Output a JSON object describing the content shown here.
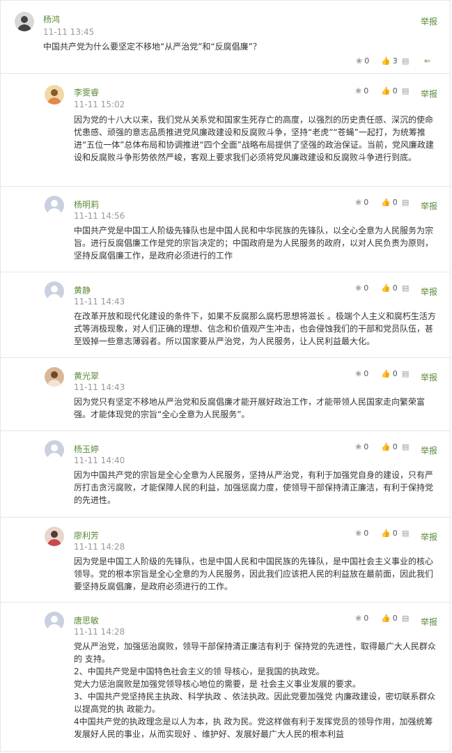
{
  "post": {
    "author": "杨鸿",
    "time": "11-11 13:45",
    "content": "中国共产党为什么要坚定不移地“从严治党”和“反腐倡廉”？",
    "report_label": "举报",
    "flowers": "0",
    "likes": "3"
  },
  "replies": [
    {
      "author": "李雯睿",
      "time": "11-11 15:02",
      "flowers": "0",
      "likes": "0",
      "report_label": "举报",
      "content": "因为党的十八大以来，我们党从关系党和国家生死存亡的高度，以强烈的历史责任感、深沉的使命忧患感、顽强的意志品质推进党风廉政建设和反腐败斗争，坚持“老虎”“苍蝇”一起打，为统筹推进“五位一体”总体布局和协调推进“四个全面”战略布局提供了坚强的政治保证。当前，党风廉政建设和反腐败斗争形势依然严峻，客观上要求我们必须将党风廉政建设和反腐败斗争进行到底。"
    },
    {
      "author": "杨明莉",
      "time": "11-11 14:56",
      "flowers": "0",
      "likes": "0",
      "report_label": "举报",
      "content": "中国共产党是中国工人阶级先锋队也是中国人民和中华民族的先锋队，以全心全意为人民服务为宗旨。进行反腐倡廉工作是党的宗旨决定的；中国政府是为人民服务的政府，以对人民负责为原则，坚持反腐倡廉工作，是政府必须进行的工作"
    },
    {
      "author": "黄静",
      "time": "11-11 14:43",
      "flowers": "0",
      "likes": "0",
      "report_label": "举报",
      "content": "在改革开放和现代化建设的条件下，如果不反腐那么腐朽思想将滋长 。极端个人主义和腐朽生活方式等消极现象，对人们正确的理想、信念和价值观产生冲击，也会侵蚀我们的干部和党员队伍，甚至毁掉一些意志薄弱者。所以国家要从严治党，为人民服务，让人民利益最大化。"
    },
    {
      "author": "黄光翠",
      "time": "11-11 14:43",
      "flowers": "0",
      "likes": "0",
      "report_label": "举报",
      "content": "因为党只有坚定不移地从严治党和反腐倡廉才能开展好政治工作，才能带领人民国家走向繁荣富强。才能体现党的宗旨“全心全意为人民服务”。"
    },
    {
      "author": "杨玉婷",
      "time": "11-11 14:40",
      "flowers": "0",
      "likes": "0",
      "report_label": "举报",
      "content": "因为中国共产党的宗旨是全心全意为人民服务，坚持从严治党，有利于加强党自身的建设，只有严厉打击贪污腐败，才能保障人民的利益，加强惩腐力度，使领导干部保持清正廉洁，有利于保持党的先进性。"
    },
    {
      "author": "廖利芳",
      "time": "11-11 14:28",
      "flowers": "0",
      "likes": "0",
      "report_label": "举报",
      "content": "因为党是中国工人阶级的先锋队，也是中国人民和中国民族的先锋队，是中国社会主义事业的核心领导。党的根本宗旨是全心全意的为人民服务，因此我们应该把人民的利益放在最前面，因此我们要坚持反腐倡廉，是政府必须进行的工作。"
    },
    {
      "author": "唐思敏",
      "time": "11-11 14:28",
      "flowers": "0",
      "likes": "0",
      "report_label": "举报",
      "content_lines": [
        "党从严治党，加强惩治腐败，领导干部保持清正廉洁有利于 保持党的先进性，取得最广大人民群众的 支持。",
        "2、中国共产党是中国特色社会主义的领 导核心，是我国的执政党。",
        "党大力惩治腐败是加强党领导核心地位的需要，是 社会主义事业发展的要求。",
        "3、中国共产党坚持民主执政、科学执政 、依法执政。因此党要加强党 内廉政建设，密切联系群众以提高党的执 政能力。",
        "4中国共产党的执政理念是以人为本，执 政为民。党这样做有利于发挥党员的领导作用，加强统筹发展好人民的事业，从而实现好 、维护好、发展好最广大人民的根本利益"
      ]
    }
  ],
  "colors": {
    "accent": "#5a8a3a",
    "muted": "#999999",
    "border": "#e6e6e6"
  }
}
